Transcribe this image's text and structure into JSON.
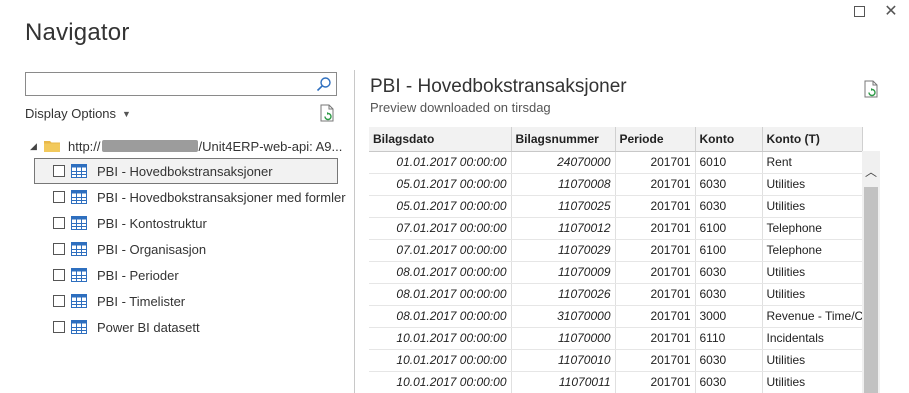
{
  "window": {
    "maximize_glyph": "maximize",
    "close_glyph": "✕"
  },
  "title": "Navigator",
  "search": {
    "value": "",
    "placeholder": ""
  },
  "display_options": {
    "label": "Display Options",
    "caret": "▼"
  },
  "tree": {
    "root": {
      "expander": "◢",
      "prefix": "http://",
      "suffix": "/Unit4ERP-web-api: A9..."
    },
    "items": [
      {
        "label": "PBI - Hovedbokstransaksjoner",
        "selected": true
      },
      {
        "label": "PBI - Hovedbokstransaksjoner med formler",
        "selected": false
      },
      {
        "label": "PBI - Kontostruktur",
        "selected": false
      },
      {
        "label": "PBI - Organisasjon",
        "selected": false
      },
      {
        "label": "PBI - Perioder",
        "selected": false
      },
      {
        "label": "PBI - Timelister",
        "selected": false
      },
      {
        "label": "Power BI datasett",
        "selected": false
      }
    ]
  },
  "preview": {
    "title": "PBI - Hovedbokstransaksjoner",
    "subtitle": "Preview downloaded on tirsdag",
    "columns": [
      "Bilagsdato",
      "Bilagsnummer",
      "Periode",
      "Konto",
      "Konto (T)"
    ],
    "rows": [
      [
        "01.01.2017 00:00:00",
        "24070000",
        "201701",
        "6010",
        "Rent"
      ],
      [
        "05.01.2017 00:00:00",
        "11070008",
        "201701",
        "6030",
        "Utilities"
      ],
      [
        "05.01.2017 00:00:00",
        "11070025",
        "201701",
        "6030",
        "Utilities"
      ],
      [
        "07.01.2017 00:00:00",
        "11070012",
        "201701",
        "6100",
        "Telephone"
      ],
      [
        "07.01.2017 00:00:00",
        "11070029",
        "201701",
        "6100",
        "Telephone"
      ],
      [
        "08.01.2017 00:00:00",
        "11070009",
        "201701",
        "6030",
        "Utilities"
      ],
      [
        "08.01.2017 00:00:00",
        "11070026",
        "201701",
        "6030",
        "Utilities"
      ],
      [
        "08.01.2017 00:00:00",
        "31070000",
        "201701",
        "3000",
        "Revenue - Time/Co"
      ],
      [
        "10.01.2017 00:00:00",
        "11070000",
        "201701",
        "6110",
        "Incidentals"
      ],
      [
        "10.01.2017 00:00:00",
        "11070010",
        "201701",
        "6030",
        "Utilities"
      ],
      [
        "10.01.2017 00:00:00",
        "11070011",
        "201701",
        "6030",
        "Utilities"
      ]
    ]
  },
  "colors": {
    "accent_blue": "#2e6fbf",
    "folder_yellow": "#e8b84a",
    "refresh_green": "#2e9b47"
  }
}
